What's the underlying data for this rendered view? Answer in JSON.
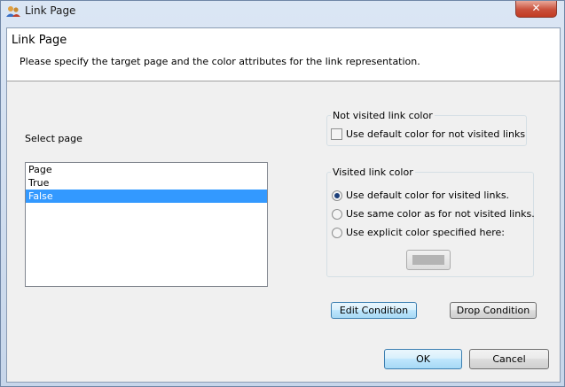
{
  "window": {
    "title": "Link Page",
    "close_glyph": "✕"
  },
  "header": {
    "title": "Link Page",
    "description": "Please specify the target page and the color attributes for the link representation."
  },
  "page_select": {
    "label": "Select page",
    "items": [
      "Page",
      "True",
      "False"
    ],
    "selected": "False"
  },
  "not_visited": {
    "legend": "Not visited link color",
    "use_default_label": "Use default color for not visited links",
    "use_default_checked": false
  },
  "visited": {
    "legend": "Visited link color",
    "options": [
      "Use default color for visited links.",
      "Use same color as for not visited links.",
      "Use explicit color specified here:"
    ],
    "selected_index": 0,
    "explicit_color": "#b4b4b4"
  },
  "buttons": {
    "edit_condition": "Edit Condition",
    "drop_condition": "Drop Condition",
    "ok": "OK",
    "cancel": "Cancel"
  },
  "colors": {
    "selection": "#3399ff",
    "radio_dot": "#1c3f7a"
  }
}
